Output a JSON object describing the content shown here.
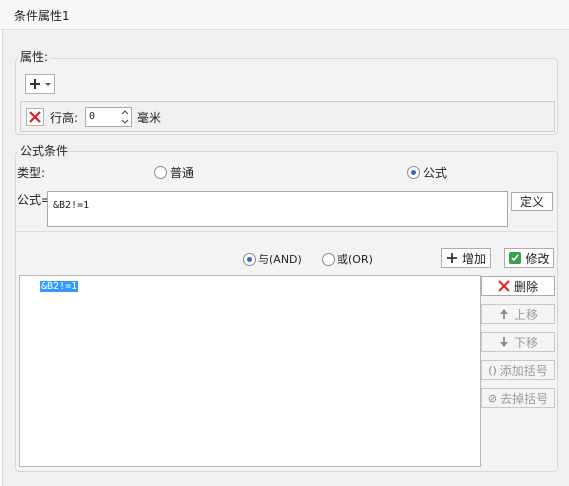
{
  "window": {
    "title": "条件属性1"
  },
  "attributes": {
    "group_label": "属性:",
    "row_height_label": "行高:",
    "row_height_value": "0",
    "unit": "毫米"
  },
  "formula_condition": {
    "group_label": "公式条件",
    "type_label": "类型:",
    "type_options": [
      {
        "label": "普通",
        "selected": false
      },
      {
        "label": "公式",
        "selected": true
      }
    ],
    "formula_label": "公式=",
    "formula_value": "&B2!=1",
    "define_label": "定义",
    "logic_options": [
      {
        "label": "与(AND)",
        "selected": true
      },
      {
        "label": "或(OR)",
        "selected": false
      }
    ],
    "add_label": "增加",
    "modify_label": "修改",
    "conditions": [
      "&B2!=1"
    ],
    "side_buttons": {
      "delete": "删除",
      "move_up": "上移",
      "move_down": "下移",
      "add_bracket": "添加括号",
      "remove_bracket": "去掉括号"
    }
  }
}
